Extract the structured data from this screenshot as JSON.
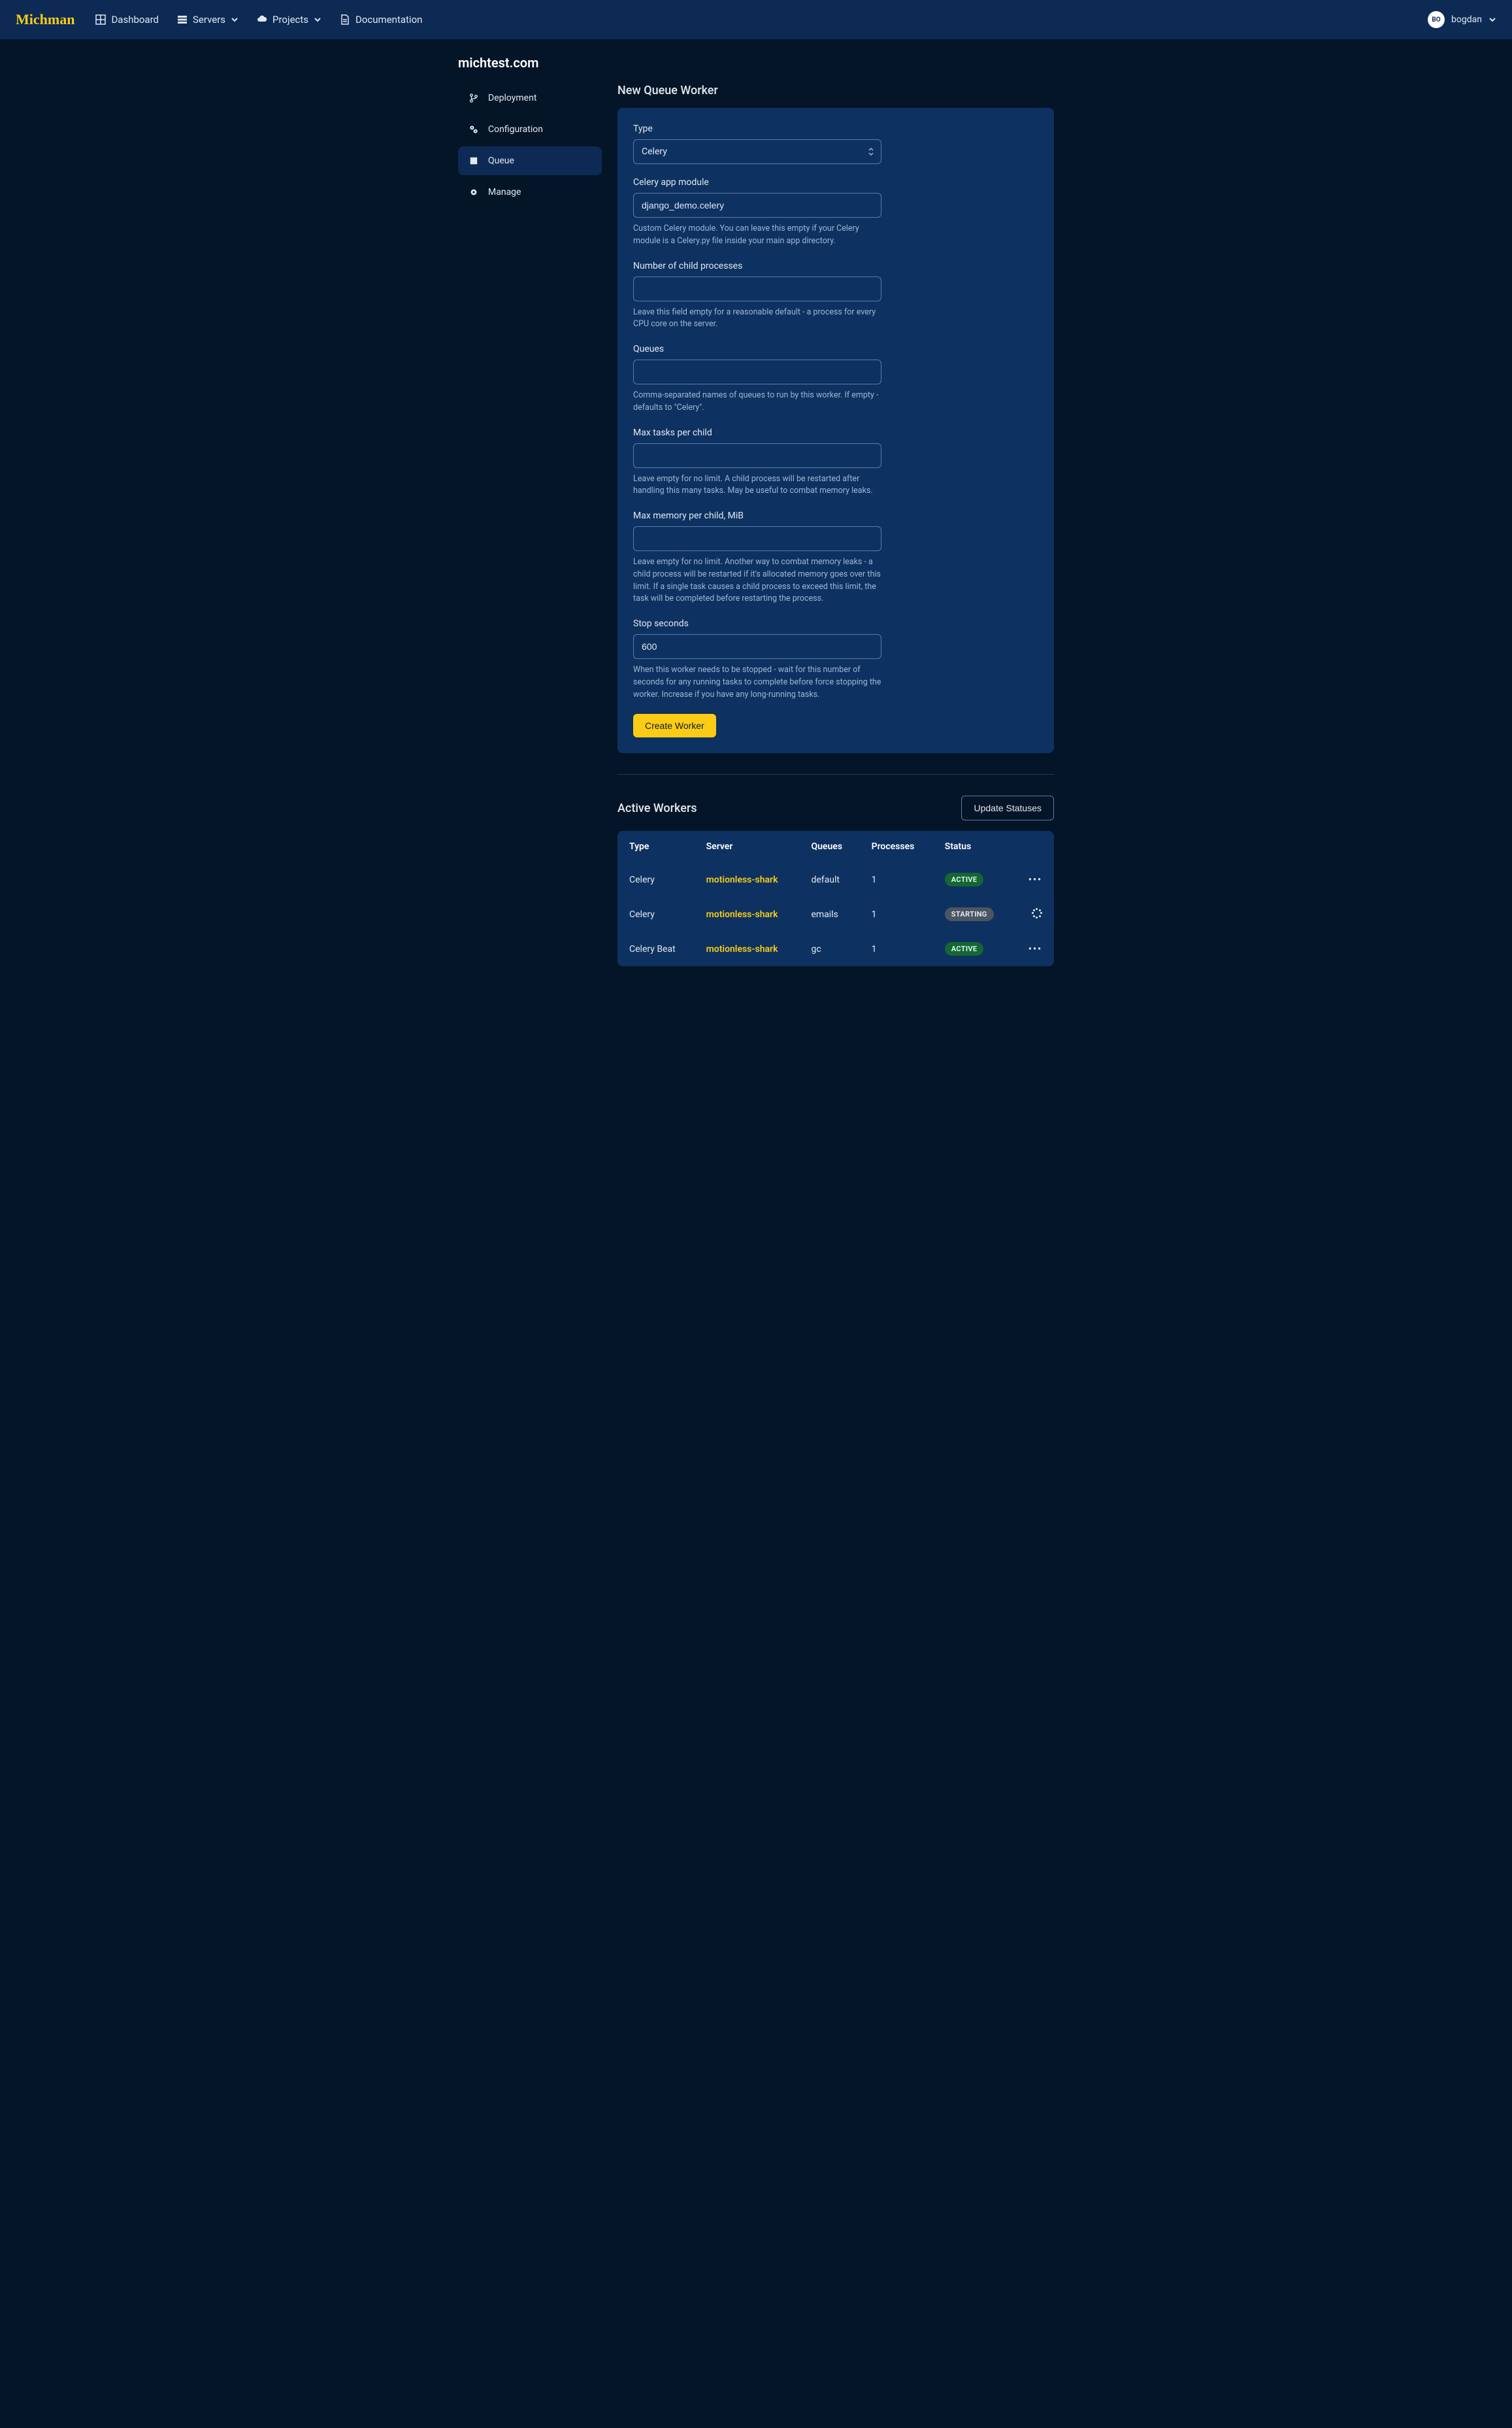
{
  "brand": "Michman",
  "nav": {
    "dashboard": "Dashboard",
    "servers": "Servers",
    "projects": "Projects",
    "documentation": "Documentation"
  },
  "user": {
    "initials": "BO",
    "name": "bogdan"
  },
  "domain": "michtest.com",
  "sidebar": {
    "deployment": "Deployment",
    "configuration": "Configuration",
    "queue": "Queue",
    "manage": "Manage"
  },
  "form": {
    "title": "New Queue Worker",
    "type_label": "Type",
    "type_value": "Celery",
    "app_label": "Celery app module",
    "app_value": "django_demo.celery",
    "app_help": "Custom Celery module. You can leave this empty if your Celery module is a Celery.py file inside your main app directory.",
    "processes_label": "Number of child processes",
    "processes_value": "",
    "processes_help": "Leave this field empty for a reasonable default - a process for every CPU core on the server.",
    "queues_label": "Queues",
    "queues_value": "",
    "queues_help": "Comma-separated names of queues to run by this worker. If empty - defaults to \"Celery\".",
    "maxtasks_label": "Max tasks per child",
    "maxtasks_value": "",
    "maxtasks_help": "Leave empty for no limit. A child process will be restarted after handling this many tasks. May be useful to combat memory leaks.",
    "maxmem_label": "Max memory per child, MiB",
    "maxmem_value": "",
    "maxmem_help": "Leave empty for no limit. Another way to combat memory leaks - a child process will be restarted if it's allocated memory goes over this limit. If a single task causes a child process to exceed this limit, the task will be completed before restarting the process.",
    "stop_label": "Stop seconds",
    "stop_value": "600",
    "stop_help": "When this worker needs to be stopped - wait for this number of seconds for any running tasks to complete before force stopping the worker. Increase if you have any long-running tasks.",
    "submit": "Create Worker"
  },
  "active": {
    "title": "Active Workers",
    "update_btn": "Update Statuses",
    "headers": {
      "type": "Type",
      "server": "Server",
      "queues": "Queues",
      "processes": "Processes",
      "status": "Status"
    },
    "rows": [
      {
        "type": "Celery",
        "server": "motionless-shark",
        "queues": "default",
        "processes": "1",
        "status": "ACTIVE",
        "status_kind": "active",
        "action": "dots"
      },
      {
        "type": "Celery",
        "server": "motionless-shark",
        "queues": "emails",
        "processes": "1",
        "status": "STARTING",
        "status_kind": "starting",
        "action": "spinner"
      },
      {
        "type": "Celery Beat",
        "server": "motionless-shark",
        "queues": "gc",
        "processes": "1",
        "status": "ACTIVE",
        "status_kind": "active",
        "action": "dots"
      }
    ]
  }
}
